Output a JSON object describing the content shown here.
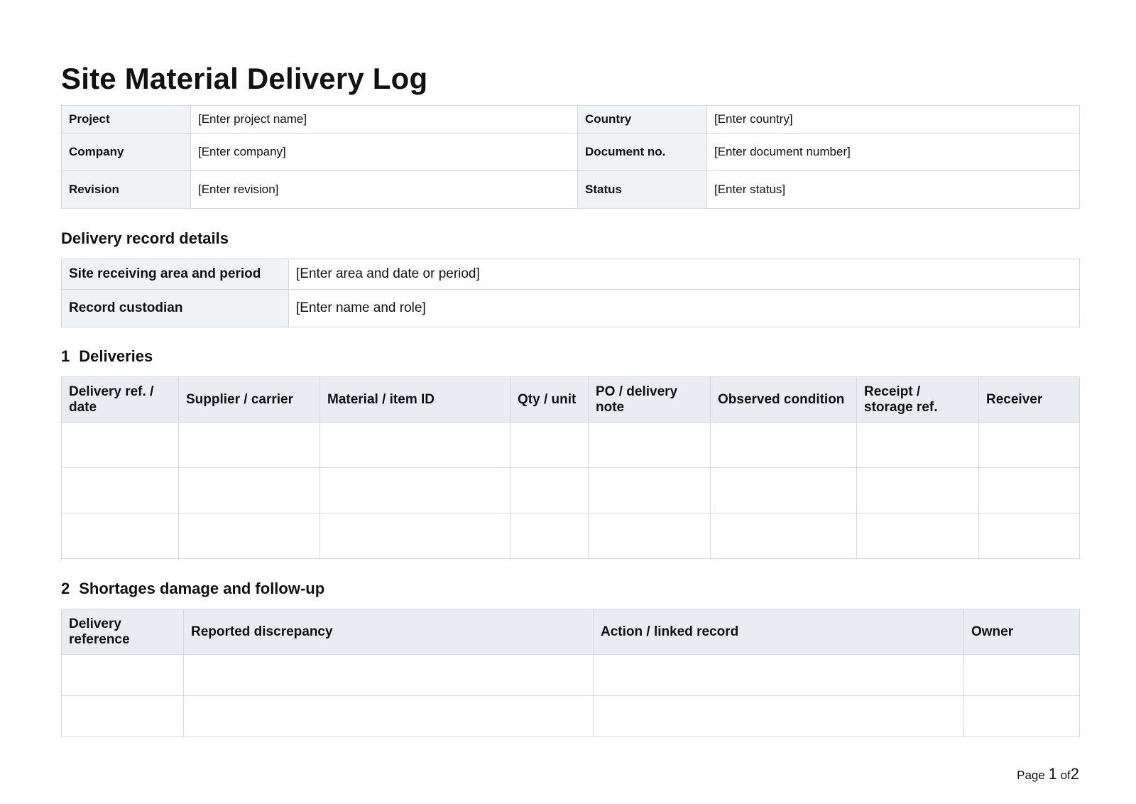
{
  "document": {
    "title": "Site Material Delivery Log"
  },
  "meta": [
    {
      "label": "Project",
      "value": "[Enter project name]",
      "label2": "Country",
      "value2": "[Enter country]"
    },
    {
      "label": "Company",
      "value": "[Enter company]",
      "label2": "Document no.",
      "value2": "[Enter document number]"
    },
    {
      "label": "Revision",
      "value": "[Enter revision]",
      "label2": "Status",
      "value2": "[Enter status]"
    }
  ],
  "details": {
    "heading": "Delivery record details",
    "rows": [
      {
        "label": "Site receiving area and period",
        "value": "[Enter area and date or period]"
      },
      {
        "label": "Record custodian",
        "value": "[Enter name and role]"
      }
    ]
  },
  "deliveries": {
    "number": "1",
    "heading": "Deliveries",
    "columns": [
      "Delivery ref. / date",
      "Supplier / carrier",
      "Material / item ID",
      "Qty / unit",
      "PO / delivery note",
      "Observed condition",
      "Receipt / storage ref.",
      "Receiver"
    ],
    "rows": [
      [
        "",
        "",
        "",
        "",
        "",
        "",
        "",
        ""
      ],
      [
        "",
        "",
        "",
        "",
        "",
        "",
        "",
        ""
      ],
      [
        "",
        "",
        "",
        "",
        "",
        "",
        "",
        ""
      ]
    ]
  },
  "shortages": {
    "number": "2",
    "heading": "Shortages damage and follow-up",
    "columns": [
      "Delivery reference",
      "Reported discrepancy",
      "Action / linked record",
      "Owner"
    ],
    "rows": [
      [
        "",
        "",
        "",
        ""
      ],
      [
        "",
        "",
        "",
        ""
      ]
    ]
  },
  "footer": {
    "page_word": "Page",
    "current_page": "1",
    "of_word": "of",
    "total_pages": "2"
  }
}
